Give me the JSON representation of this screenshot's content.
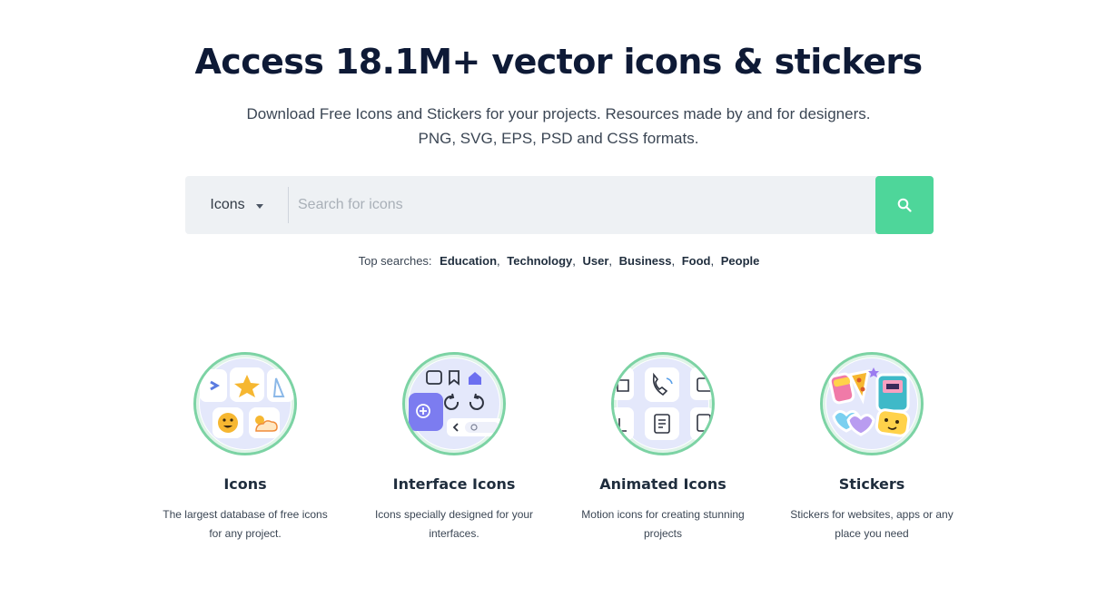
{
  "hero": {
    "title": "Access 18.1M+ vector icons & stickers",
    "subtitle_line1": "Download Free Icons and Stickers for your projects. Resources made by and for designers.",
    "subtitle_line2": "PNG, SVG, EPS, PSD and CSS formats."
  },
  "search": {
    "type_selected": "Icons",
    "placeholder": "Search for icons",
    "button_icon": "search-icon",
    "button_color": "#4ed69a"
  },
  "top_searches": {
    "label": "Top searches:",
    "items": [
      "Education",
      "Technology",
      "User",
      "Business",
      "Food",
      "People"
    ]
  },
  "categories": [
    {
      "title": "Icons",
      "desc_line1": "The largest database of free icons",
      "desc_line2": "for any project.",
      "icon": "icons-preview"
    },
    {
      "title": "Interface Icons",
      "desc_line1": "Icons specially designed for your",
      "desc_line2": "interfaces.",
      "icon": "interface-icons-preview"
    },
    {
      "title": "Animated Icons",
      "desc_line1": "Motion icons for creating stunning",
      "desc_line2": "projects",
      "icon": "animated-icons-preview"
    },
    {
      "title": "Stickers",
      "desc_line1": "Stickers for websites, apps or any",
      "desc_line2": "place you need",
      "icon": "stickers-preview"
    }
  ],
  "colors": {
    "accent": "#4ed69a",
    "circle_border": "#7cd3a4",
    "title": "#0e1a36"
  }
}
